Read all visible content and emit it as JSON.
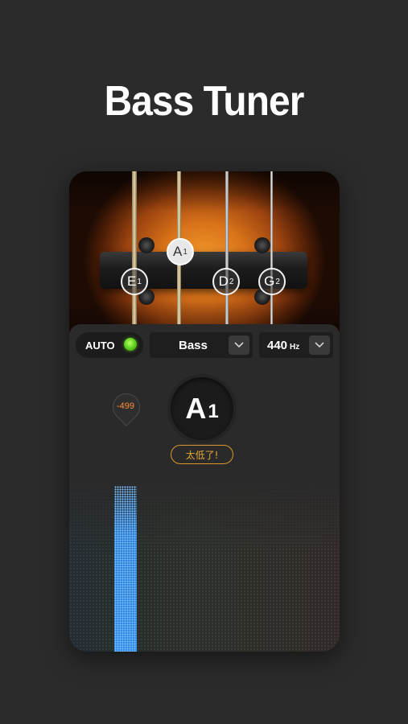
{
  "headline": "Bass Tuner",
  "strings": [
    {
      "note": "E",
      "octave": "1",
      "color": "#e6e6e6",
      "active": false
    },
    {
      "note": "A",
      "octave": "1",
      "color": "#d9c5a0",
      "active": true
    },
    {
      "note": "D",
      "octave": "2",
      "color": "#e6e6e6",
      "active": false
    },
    {
      "note": "G",
      "octave": "2",
      "color": "#e6e6e6",
      "active": false
    }
  ],
  "controls": {
    "auto_label": "AUTO",
    "auto_on": true,
    "instrument": "Bass",
    "reference": "440",
    "reference_unit": "Hz"
  },
  "tuner": {
    "note": "A",
    "octave": "1",
    "cents": "-499",
    "status": "太低了!",
    "status_color": "#e6a832"
  },
  "meter": {
    "accent": "#2f8ae8",
    "level": 0.95
  }
}
